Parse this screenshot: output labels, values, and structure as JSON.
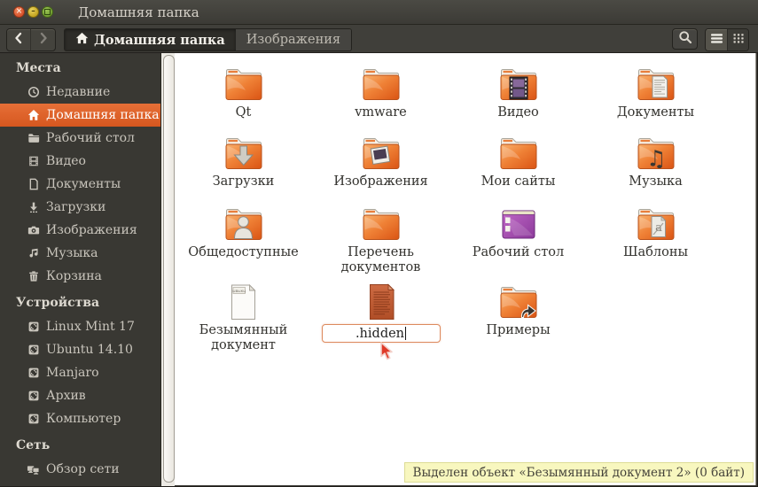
{
  "window": {
    "title": "Домашняя папка",
    "controls": {
      "close": "close",
      "minimize": "minimize",
      "maximize": "maximize"
    }
  },
  "toolbar": {
    "breadcrumbs": [
      {
        "label": "Домашняя папка",
        "icon": "home",
        "active": true
      },
      {
        "label": "Изображения",
        "active": false
      }
    ],
    "view_modes": [
      {
        "name": "list",
        "active": true
      },
      {
        "name": "grid",
        "active": false
      }
    ]
  },
  "sidebar": {
    "sections": [
      {
        "header": "Места",
        "items": [
          {
            "label": "Недавние",
            "icon": "recent"
          },
          {
            "label": "Домашняя папка",
            "icon": "home",
            "selected": true
          },
          {
            "label": "Рабочий стол",
            "icon": "folder"
          },
          {
            "label": "Видео",
            "icon": "video"
          },
          {
            "label": "Документы",
            "icon": "document"
          },
          {
            "label": "Загрузки",
            "icon": "download"
          },
          {
            "label": "Изображения",
            "icon": "camera"
          },
          {
            "label": "Музыка",
            "icon": "music"
          },
          {
            "label": "Корзина",
            "icon": "trash"
          }
        ]
      },
      {
        "header": "Устройства",
        "items": [
          {
            "label": "Linux Mint 17",
            "icon": "drive"
          },
          {
            "label": "Ubuntu 14.10",
            "icon": "drive"
          },
          {
            "label": "Manjaro",
            "icon": "drive"
          },
          {
            "label": "Архив",
            "icon": "drive"
          },
          {
            "label": "Компьютер",
            "icon": "drive"
          }
        ]
      },
      {
        "header": "Сеть",
        "items": [
          {
            "label": "Обзор сети",
            "icon": "network"
          }
        ]
      }
    ]
  },
  "content": {
    "items": [
      {
        "label": "Qt",
        "icon": "folder"
      },
      {
        "label": "vmware",
        "icon": "folder"
      },
      {
        "label": "Видео",
        "icon": "folder-video"
      },
      {
        "label": "Документы",
        "icon": "folder-documents"
      },
      {
        "label": "Загрузки",
        "icon": "folder-download"
      },
      {
        "label": "Изображения",
        "icon": "folder-pictures"
      },
      {
        "label": "Мои сайты",
        "icon": "folder"
      },
      {
        "label": "Музыка",
        "icon": "folder-music"
      },
      {
        "label": "Общедоступные",
        "icon": "folder-public"
      },
      {
        "label": "Перечень документов",
        "icon": "folder"
      },
      {
        "label": "Рабочий стол",
        "icon": "desktop"
      },
      {
        "label": "Шаблоны",
        "icon": "folder-templates"
      },
      {
        "label": "Безымянный документ",
        "icon": "text-document"
      },
      {
        "label": ".hidden",
        "icon": "document-orange",
        "renaming": true
      },
      {
        "label": "Примеры",
        "icon": "folder-link"
      }
    ],
    "doc_preview": "ывыкц",
    "rename_value": ".hidden",
    "status_text": "Выделен объект «Безымянный документ 2» (0 байт)"
  },
  "colors": {
    "accent": "#dd5f2a",
    "folder_orange": "#ef7c33",
    "desktop_purple": "#9b44ab",
    "status_bg": "#f8f7bf",
    "sidebar_bg": "#393833",
    "titlebar_bg": "#403f3a"
  }
}
